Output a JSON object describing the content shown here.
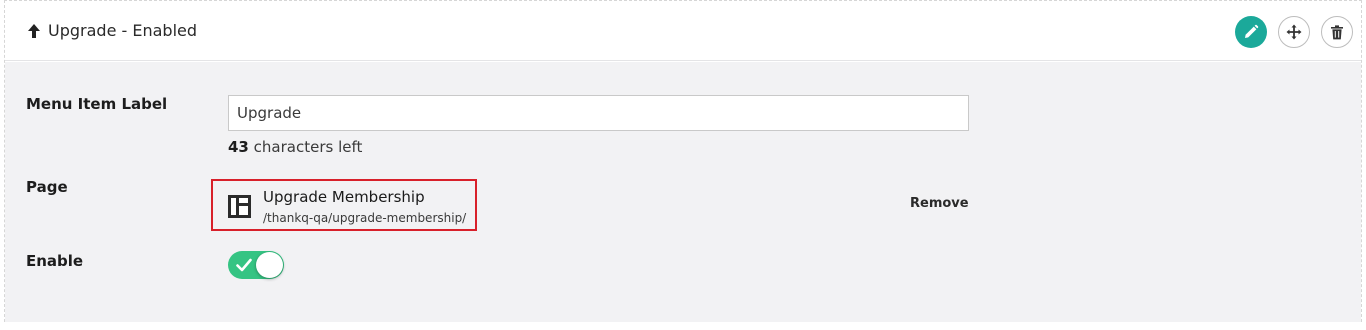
{
  "header": {
    "title": "Upgrade - Enabled",
    "arrow_icon": "arrow-up-icon",
    "actions": {
      "edit_icon": "pencil-icon",
      "move_icon": "move-icon",
      "delete_icon": "trash-icon",
      "edit_color": "#1ba99a"
    }
  },
  "form": {
    "menu_item_label": {
      "label": "Menu Item Label",
      "value": "Upgrade",
      "counter_number": "43",
      "counter_text": "characters left"
    },
    "page": {
      "label": "Page",
      "title": "Upgrade Membership",
      "path": "/thankq-qa/upgrade-membership/",
      "icon": "page-layout-icon",
      "remove_label": "Remove",
      "highlight_color": "#d8202a"
    },
    "enable": {
      "label": "Enable",
      "checked": true,
      "toggle_color": "#35c483"
    }
  }
}
